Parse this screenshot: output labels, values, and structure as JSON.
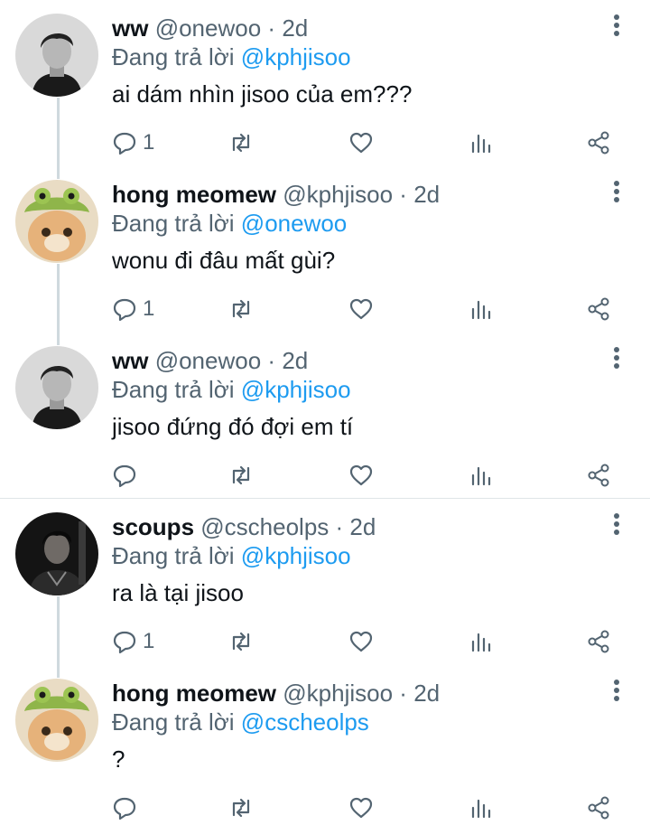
{
  "replying_prefix": "Đang trả lời",
  "tweets": [
    {
      "name": "ww",
      "handle": "@onewoo",
      "sep": "·",
      "time": "2d",
      "reply_to": "@kphjisoo",
      "text": "ai dám nhìn jisoo của em???",
      "reply_count": "1",
      "avatar": "person-grayscale"
    },
    {
      "name": "hong meomew",
      "handle": "@kphjisoo",
      "sep": "·",
      "time": "2d",
      "reply_to": "@onewoo",
      "text": "wonu đi đâu mất gùi?",
      "reply_count": "1",
      "avatar": "cat-with-frog-hat"
    },
    {
      "name": "ww",
      "handle": "@onewoo",
      "sep": "·",
      "time": "2d",
      "reply_to": "@kphjisoo",
      "text": "jisoo đứng đó đợi em tí",
      "reply_count": "",
      "avatar": "person-grayscale"
    },
    {
      "name": "scoups",
      "handle": "@cscheolps",
      "sep": "·",
      "time": "2d",
      "reply_to": "@kphjisoo",
      "text": "ra là tại jisoo",
      "reply_count": "1",
      "avatar": "person-dark"
    },
    {
      "name": "hong meomew",
      "handle": "@kphjisoo",
      "sep": "·",
      "time": "2d",
      "reply_to": "@cscheolps",
      "text": "?",
      "reply_count": "",
      "avatar": "cat-with-frog-hat"
    }
  ],
  "colors": {
    "text": "#0f1419",
    "secondary": "#536471",
    "mention": "#1d9bf0",
    "thread_line": "#cfd9de"
  }
}
